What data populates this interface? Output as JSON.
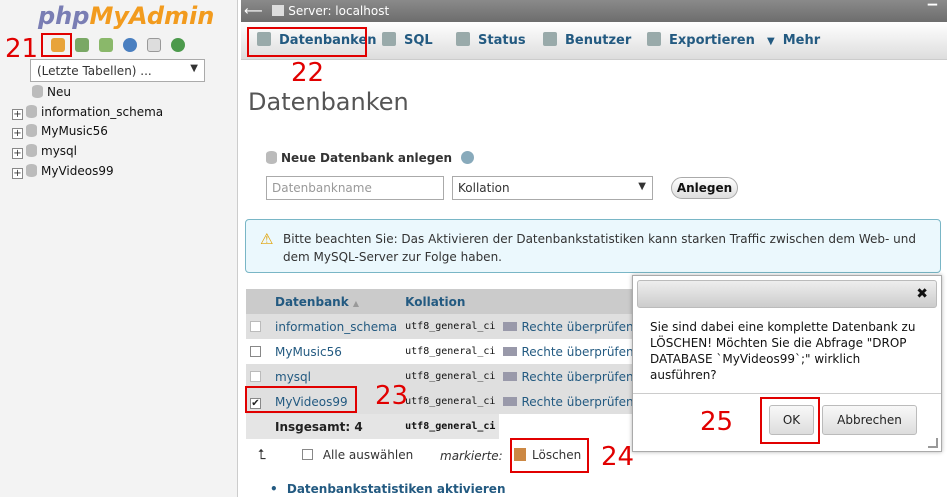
{
  "sidebar": {
    "logo_php": "php",
    "logo_admin": "MyAdmin",
    "recent_tables": "(Letzte Tabellen) ...",
    "tree": [
      "Neu",
      "information_schema",
      "MyMusic56",
      "mysql",
      "MyVideos99"
    ],
    "icons": [
      "home-icon",
      "table-icon",
      "exit-icon",
      "help-icon",
      "docs-icon",
      "reload-icon"
    ]
  },
  "topbar": {
    "title": "Server: localhost"
  },
  "tabs": [
    "Datenbanken",
    "SQL",
    "Status",
    "Benutzer",
    "Exportieren",
    "Mehr"
  ],
  "page_title": "Datenbanken",
  "create": {
    "heading": "Neue Datenbank anlegen",
    "name_placeholder": "Datenbankname",
    "collation_value": "Kollation",
    "button": "Anlegen"
  },
  "notice": "Bitte beachten Sie: Das Aktivieren der Datenbankstatistiken kann starken Traffic zwischen dem Web- und dem MySQL-Server zur Folge haben.",
  "table": {
    "col_db": "Datenbank",
    "col_coll": "Kollation",
    "rows": [
      {
        "name": "information_schema",
        "coll": "utf8_general_ci",
        "action": "Rechte überprüfen",
        "checked": false
      },
      {
        "name": "MyMusic56",
        "coll": "utf8_general_ci",
        "action": "Rechte überprüfen",
        "checked": false
      },
      {
        "name": "mysql",
        "coll": "utf8_general_ci",
        "action": "Rechte überprüfen",
        "checked": false
      },
      {
        "name": "MyVideos99",
        "coll": "utf8_general_ci",
        "action": "Rechte überprüfen",
        "checked": true
      }
    ],
    "total_label": "Insgesamt: 4",
    "total_coll": "utf8_general_ci"
  },
  "bulk": {
    "select_all": "Alle auswählen",
    "marked": "markierte:",
    "delete": "Löschen"
  },
  "stats_link": "Datenbankstatistiken aktivieren",
  "dialog": {
    "close": "✖",
    "message": "Sie sind dabei eine komplette Datenbank zu LÖSCHEN! Möchten Sie die Abfrage \"DROP DATABASE `MyVideos99`;\" wirklich ausführen?",
    "ok": "OK",
    "cancel": "Abbrechen"
  },
  "annotations": [
    "21",
    "22",
    "23",
    "24",
    "25"
  ],
  "colors": {
    "link": "#235a81",
    "annotation": "#e10000",
    "logo_php": "#7a7eb4",
    "logo_admin": "#f29b1e"
  }
}
